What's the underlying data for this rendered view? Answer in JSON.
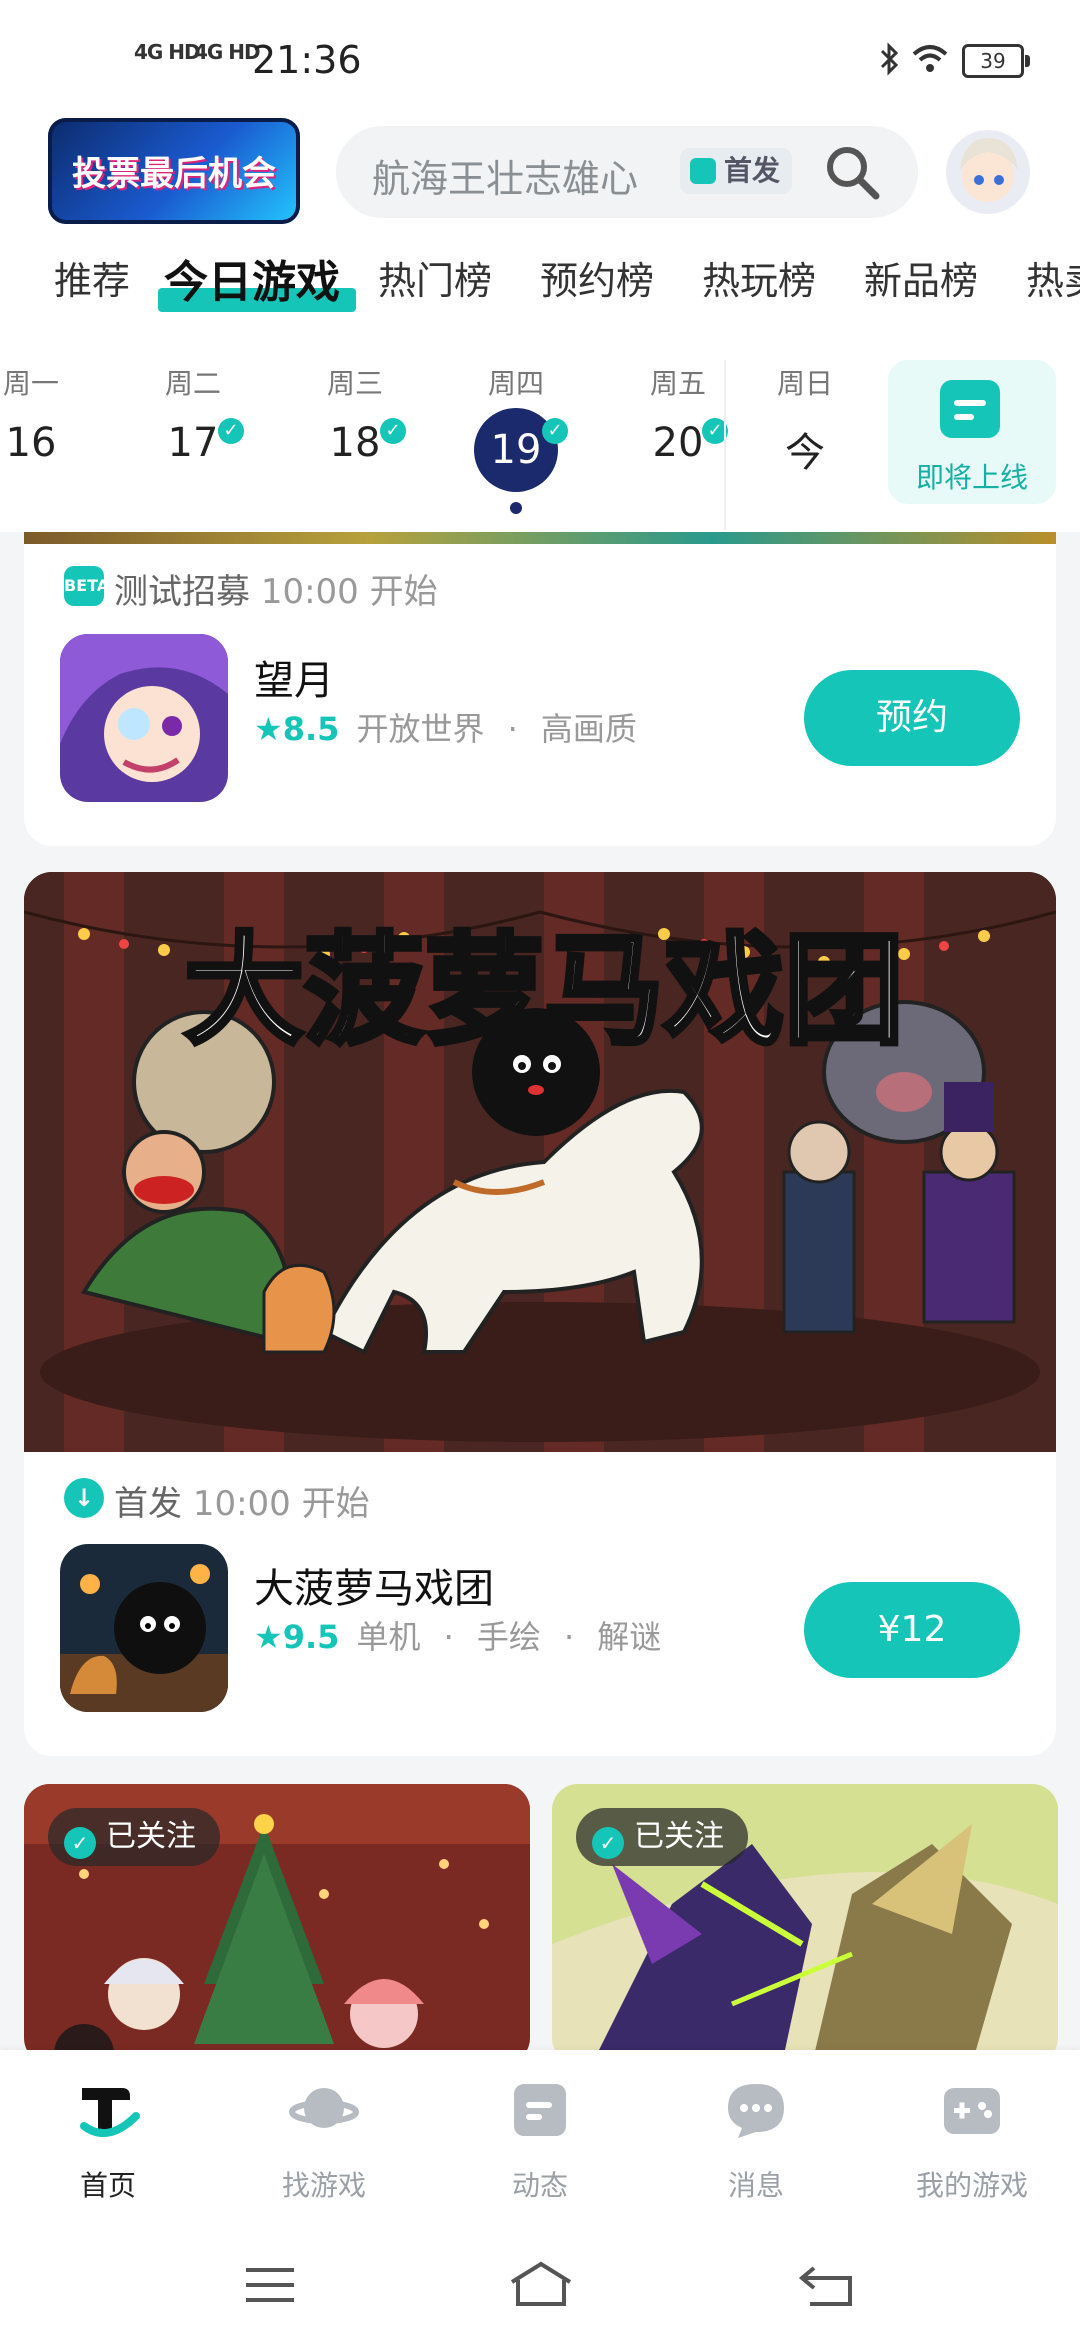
{
  "status_bar": {
    "signal1": "4G HD",
    "signal2": "4G HD",
    "time": "21:36",
    "battery": "39"
  },
  "header": {
    "promo_label": "投票最后机会",
    "search_placeholder": "航海王壮志雄心",
    "search_badge": "首发"
  },
  "tabs": [
    "推荐",
    "今日游戏",
    "热门榜",
    "预约榜",
    "热玩榜",
    "新品榜",
    "热卖"
  ],
  "date_strip": {
    "days": [
      {
        "dow": "周一",
        "num": "16",
        "checked": false
      },
      {
        "dow": "周二",
        "num": "17",
        "checked": true
      },
      {
        "dow": "周三",
        "num": "18",
        "checked": true
      },
      {
        "dow": "周四",
        "num": "19",
        "checked": true
      },
      {
        "dow": "周五",
        "num": "20",
        "checked": true
      },
      {
        "dow": "周日",
        "num": "今",
        "checked": false
      }
    ],
    "upcoming_label": "即将上线"
  },
  "cards": [
    {
      "meta_icon": "BETA",
      "meta_type": "测试招募",
      "meta_time": "10:00 开始",
      "name": "望月",
      "rating": "8.5",
      "tags": [
        "开放世界",
        "高画质"
      ],
      "button": "预约"
    },
    {
      "banner_title": "大菠萝马戏团",
      "meta_type": "首发",
      "meta_time": "10:00 开始",
      "name": "大菠萝马戏团",
      "rating": "9.5",
      "tags": [
        "单机",
        "手绘",
        "解谜"
      ],
      "button": "¥12"
    }
  ],
  "small_cards": [
    {
      "follow_label": "已关注"
    },
    {
      "follow_label": "已关注"
    }
  ],
  "bottom_nav": [
    {
      "label": "首页",
      "icon": "taptap-logo-icon",
      "active": true
    },
    {
      "label": "找游戏",
      "icon": "planet-icon",
      "active": false
    },
    {
      "label": "动态",
      "icon": "feed-icon",
      "active": false
    },
    {
      "label": "消息",
      "icon": "chat-icon",
      "active": false
    },
    {
      "label": "我的游戏",
      "icon": "gamepad-icon",
      "active": false
    }
  ],
  "colors": {
    "accent": "#15c6b8",
    "today": "#1a2a6c"
  }
}
